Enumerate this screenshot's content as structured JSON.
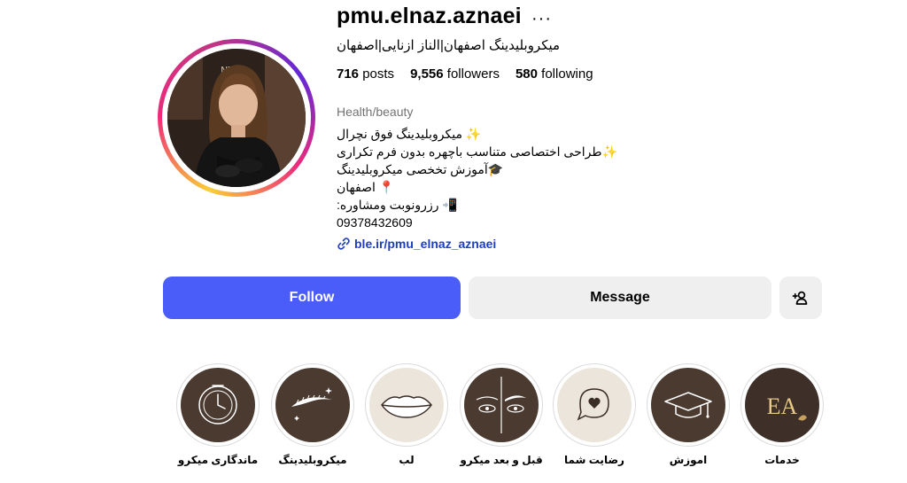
{
  "profile": {
    "username": "pmu.elnaz.aznaei",
    "more": "···",
    "full_name": "میکروبلیدینگ اصفهان|الناز ازنایی|اصفهان",
    "stats": {
      "posts_count": "716",
      "posts_label": "posts",
      "followers_count": "9,556",
      "followers_label": "followers",
      "following_count": "580",
      "following_label": "following"
    },
    "category": "Health/beauty",
    "bio_lines": [
      "✨ میکروبلیدینگ فوق نچرال",
      "✨طراحی اختصاصی متناسب باچهره بدون فرم تکراری",
      "🎓آموزش تخخصی میکروبلیدینگ",
      "📍 اصفهان",
      "📲 رزرونوبت ومشاوره:",
      "09378432609"
    ],
    "link": "ble.ir/pmu_elnaz_aznaei",
    "avatar_sign_text": "NTER"
  },
  "actions": {
    "follow": "Follow",
    "message": "Message"
  },
  "highlights": [
    {
      "label": "ماندگاری میکرو",
      "icon": "clock-icon"
    },
    {
      "label": "میکروبلیدینگ",
      "icon": "eyebrow-icon"
    },
    {
      "label": "لب",
      "icon": "lips-icon"
    },
    {
      "label": "قبل و بعد میکرو",
      "icon": "before-after-icon"
    },
    {
      "label": "رضایت شما",
      "icon": "heart-chat-icon"
    },
    {
      "label": "اموزش",
      "icon": "graduation-cap-icon"
    },
    {
      "label": "خدمات",
      "icon": "logo-ea-icon",
      "logo_text": "EA"
    }
  ],
  "colors": {
    "follow_button": "#4a5df9",
    "secondary_button": "#efefef",
    "link": "#00376b",
    "highlight_dark": "#4a3a30",
    "highlight_light": "#ece5dc"
  }
}
